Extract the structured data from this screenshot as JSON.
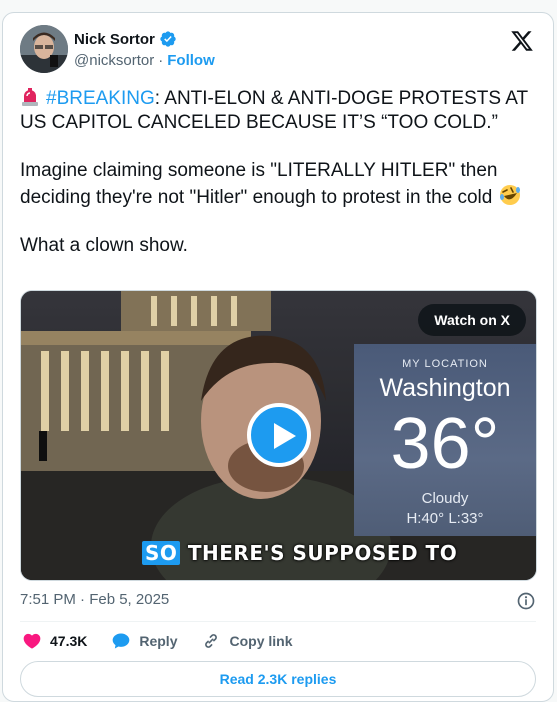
{
  "author": {
    "name": "Nick Sortor",
    "handle": "@nicksortor",
    "separator": "·",
    "follow_label": "Follow"
  },
  "tweet": {
    "hashtag": "#BREAKING",
    "line1_rest": ": ANTI-ELON & ANTI-DOGE PROTESTS AT US CAPITOL CANCELED BECAUSE IT’S “TOO COLD.”",
    "paragraph2": "Imagine claiming someone is \"LITERALLY HITLER\" then deciding they're not \"Hitler\" enough to protest in the cold",
    "paragraph3": "What a clown show.",
    "emoji_icons": [
      "rotating-light-icon",
      "rolling-on-floor-laughing-icon"
    ]
  },
  "media": {
    "watch_label": "Watch on X",
    "weather": {
      "location_label": "MY LOCATION",
      "city": "Washington",
      "temperature": "36°",
      "condition": "Cloudy",
      "high_low": "H:40°  L:33°"
    },
    "caption_highlight": "SO",
    "caption_rest": " THERE'S SUPPOSED TO"
  },
  "timestamp": "7:51 PM · Feb 5, 2025",
  "actions": {
    "likes": "47.3K",
    "reply_label": "Reply",
    "copy_label": "Copy link"
  },
  "read_replies_label": "Read 2.3K replies",
  "colors": {
    "accent": "#1d9bf0",
    "like": "#f91880",
    "text": "#0f1419",
    "secondary": "#536471"
  }
}
